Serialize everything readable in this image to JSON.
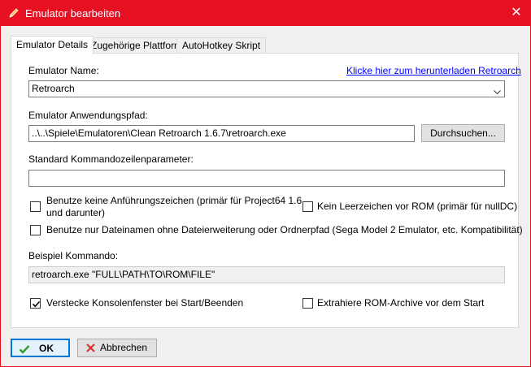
{
  "window": {
    "title": "Emulator bearbeiten",
    "close_label": "✕",
    "accent": "#e81123"
  },
  "tabs": [
    {
      "label": "Emulator Details",
      "active": true
    },
    {
      "label": "Zugehörige Plattform",
      "active": false
    },
    {
      "label": "AutoHotkey Skript",
      "active": false
    }
  ],
  "details": {
    "name_label": "Emulator Name:",
    "download_link": "Klicke hier zum herunterladen Retroarch",
    "name_value": "Retroarch",
    "path_label": "Emulator Anwendungspfad:",
    "path_value": "..\\..\\Spiele\\Emulatoren\\Clean Retroarch 1.6.7\\retroarch.exe",
    "browse_label": "Durchsuchen...",
    "params_label": "Standard Kommandozeilenparameter:",
    "params_value": "",
    "options": {
      "no_quotes": {
        "line1": "Benutze keine Anführungszeichen (primär für Project64 1.6",
        "line2": "und darunter)",
        "checked": false
      },
      "no_space": {
        "label": "Kein Leerzeichen vor ROM (primär für nullDC)",
        "checked": false
      },
      "filename_only": {
        "label": "Benutze nur Dateinamen ohne Dateierweiterung oder Ordnerpfad (Sega Model 2 Emulator, etc. Kompatibilität)",
        "checked": false
      },
      "hide_console": {
        "label": "Verstecke Konsolenfenster bei Start/Beenden",
        "checked": true
      },
      "extract_rom": {
        "label": "Extrahiere ROM-Archive vor dem Start",
        "checked": false
      }
    },
    "example_label": "Beispiel Kommando:",
    "example_value": "retroarch.exe \"FULL\\PATH\\TO\\ROM\\FILE\""
  },
  "footer": {
    "ok_label": "OK",
    "cancel_label": "Abbrechen"
  },
  "icons": {
    "title": "pencil-icon",
    "ok": "checkmark-icon",
    "cancel": "x-icon",
    "dropdown": "chevron-down-icon"
  }
}
